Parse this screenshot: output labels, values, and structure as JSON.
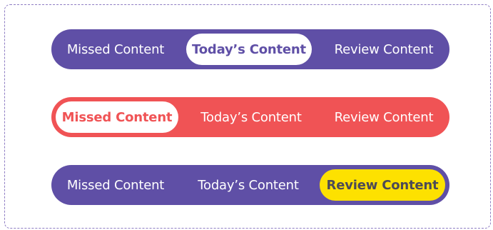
{
  "colors": {
    "purple": "#5f4fa6",
    "red": "#f05355",
    "yellow": "#fde100",
    "yellow_text": "#4c4a57",
    "white": "#ffffff",
    "dashed_border": "#8e7cc3"
  },
  "tab_bars": [
    {
      "variant": "purple",
      "active_tab": "Today’s Content",
      "tabs": [
        {
          "label": "Missed Content"
        },
        {
          "label": "Today’s Content"
        },
        {
          "label": "Review Content"
        }
      ]
    },
    {
      "variant": "red",
      "active_tab": "Missed Content",
      "tabs": [
        {
          "label": "Missed Content"
        },
        {
          "label": "Today’s Content"
        },
        {
          "label": "Review Content"
        }
      ]
    },
    {
      "variant": "purple",
      "active_tab": "Review Content",
      "tabs": [
        {
          "label": "Missed Content"
        },
        {
          "label": "Today’s Content"
        },
        {
          "label": "Review Content"
        }
      ]
    }
  ]
}
